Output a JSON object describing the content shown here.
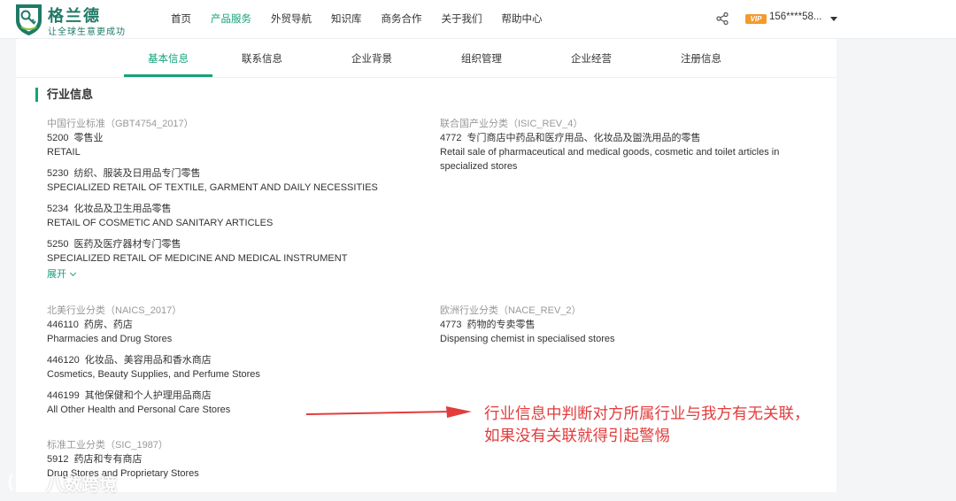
{
  "brand": {
    "name": "格兰德",
    "slogan": "让全球生意更成功"
  },
  "nav": [
    "首页",
    "产品服务",
    "外贸导航",
    "知识库",
    "商务合作",
    "关于我们",
    "帮助中心"
  ],
  "nav_active": "产品服务",
  "user": {
    "vip": "VIP",
    "phone": "156****58..."
  },
  "tabs": [
    "基本信息",
    "联系信息",
    "企业背景",
    "组织管理",
    "企业经营",
    "注册信息"
  ],
  "tab_active": "基本信息",
  "section_title": "行业信息",
  "gbt": {
    "label": "中国行业标准（GBT4754_2017）",
    "entries": [
      {
        "code": "5200",
        "cn": "零售业",
        "en": "RETAIL"
      },
      {
        "code": "5230",
        "cn": "纺织、服装及日用品专门零售",
        "en": "SPECIALIZED RETAIL OF TEXTILE, GARMENT AND DAILY NECESSITIES"
      },
      {
        "code": "5234",
        "cn": "化妆品及卫生用品零售",
        "en": "RETAIL OF COSMETIC AND SANITARY ARTICLES"
      },
      {
        "code": "5250",
        "cn": "医药及医疗器材专门零售",
        "en": "SPECIALIZED RETAIL OF MEDICINE AND MEDICAL INSTRUMENT"
      }
    ],
    "expand": "展开"
  },
  "isic": {
    "label": "联合国产业分类（ISIC_REV_4）",
    "code": "4772",
    "cn": "专门商店中药品和医疗用品、化妆品及盥洗用品的零售",
    "en_line1": "Retail sale of pharmaceutical and medical goods, cosmetic and toilet articles in",
    "en_line2": "specialized stores"
  },
  "naics": {
    "label": "北美行业分类（NAICS_2017）",
    "entries": [
      {
        "code": "446110",
        "cn": "药房、药店",
        "en": "Pharmacies and Drug Stores"
      },
      {
        "code": "446120",
        "cn": "化妆品、美容用品和香水商店",
        "en": "Cosmetics, Beauty Supplies, and Perfume Stores"
      },
      {
        "code": "446199",
        "cn": "其他保健和个人护理用品商店",
        "en": "All Other Health and Personal Care Stores"
      }
    ]
  },
  "nace": {
    "label": "欧洲行业分类（NACE_REV_2）",
    "code": "4773",
    "cn": "药物的专卖零售",
    "en": "Dispensing chemist in specialised stores"
  },
  "sic": {
    "label": "标准工业分类（SIC_1987）",
    "code": "5912",
    "cn": "药店和专有商店",
    "en": "Drug Stores and Proprietary Stores"
  },
  "annotation": {
    "line1": "行业信息中判断对方所属行业与我方有无关联，",
    "line2": "如果没有关联就得引起警惕",
    "color": "#e23c3c"
  },
  "watermark": "八数跨境",
  "colors": {
    "accent": "#15a27a",
    "brand": "#1f7a66",
    "vip": "#f39a2b"
  }
}
